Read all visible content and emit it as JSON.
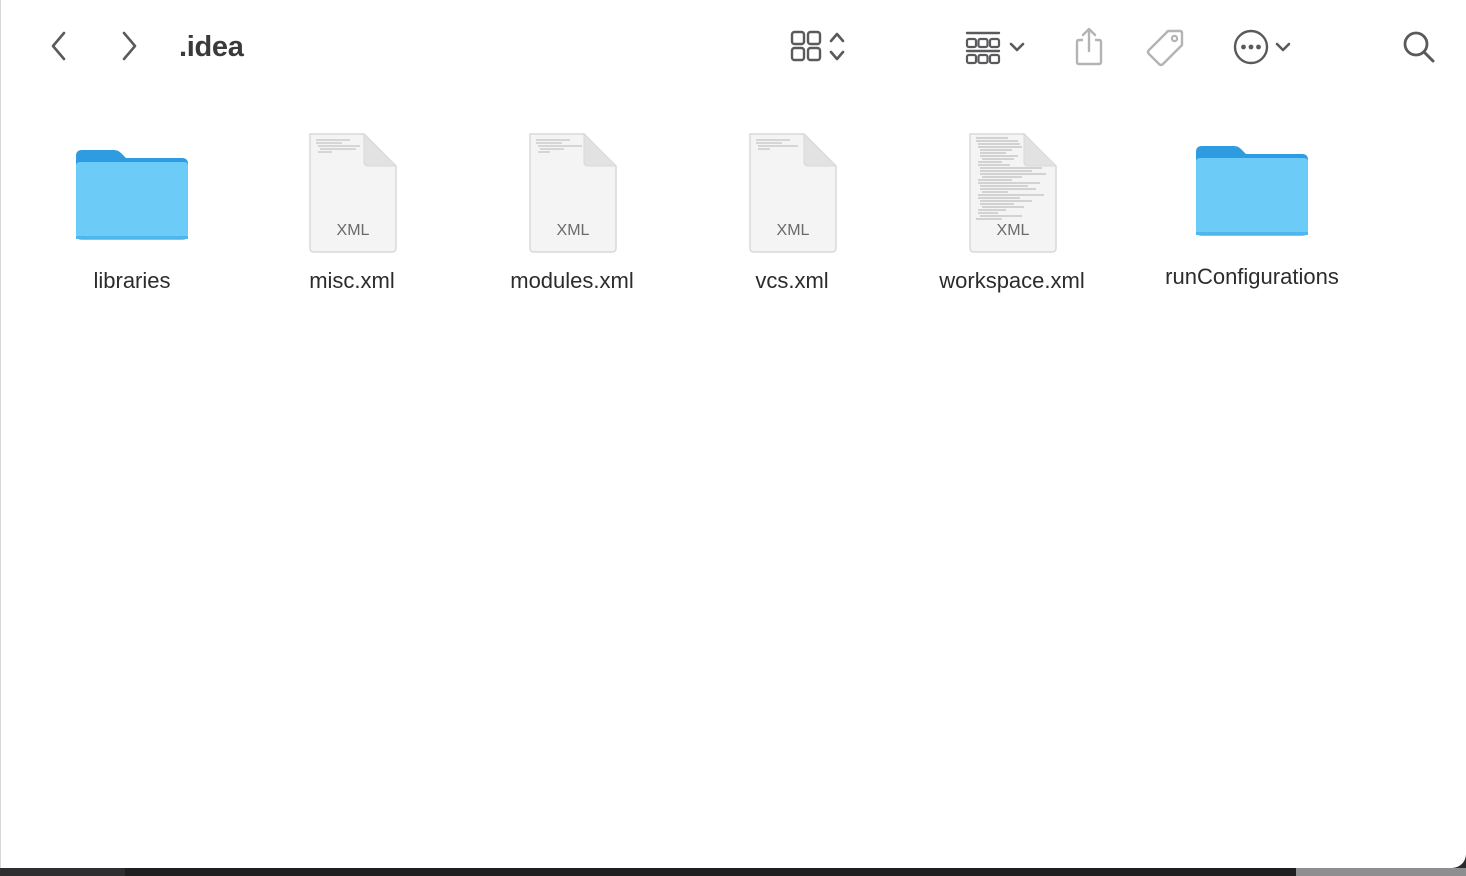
{
  "window": {
    "title": ".idea"
  },
  "toolbar": {
    "back_icon": "chevron-left-icon",
    "forward_icon": "chevron-right-icon",
    "view_icon": "grid-view-icon",
    "group_icon": "group-by-icon",
    "share_icon": "share-icon",
    "tag_icon": "tag-icon",
    "action_icon": "ellipsis-circle-icon",
    "search_icon": "search-icon"
  },
  "items": [
    {
      "name": "libraries",
      "kind": "folder"
    },
    {
      "name": "misc.xml",
      "kind": "xml",
      "badge": "XML"
    },
    {
      "name": "modules.xml",
      "kind": "xml",
      "badge": "XML"
    },
    {
      "name": "vcs.xml",
      "kind": "xml",
      "badge": "XML"
    },
    {
      "name": "workspace.xml",
      "kind": "xml",
      "badge": "XML"
    },
    {
      "name": "runConfigurations",
      "kind": "folder"
    }
  ],
  "colors": {
    "folder_front": "#6ccbf7",
    "folder_back": "#2f9be0",
    "toolbar_icon": "#5a5a5c",
    "toolbar_icon_disabled": "#b4b4b6"
  }
}
